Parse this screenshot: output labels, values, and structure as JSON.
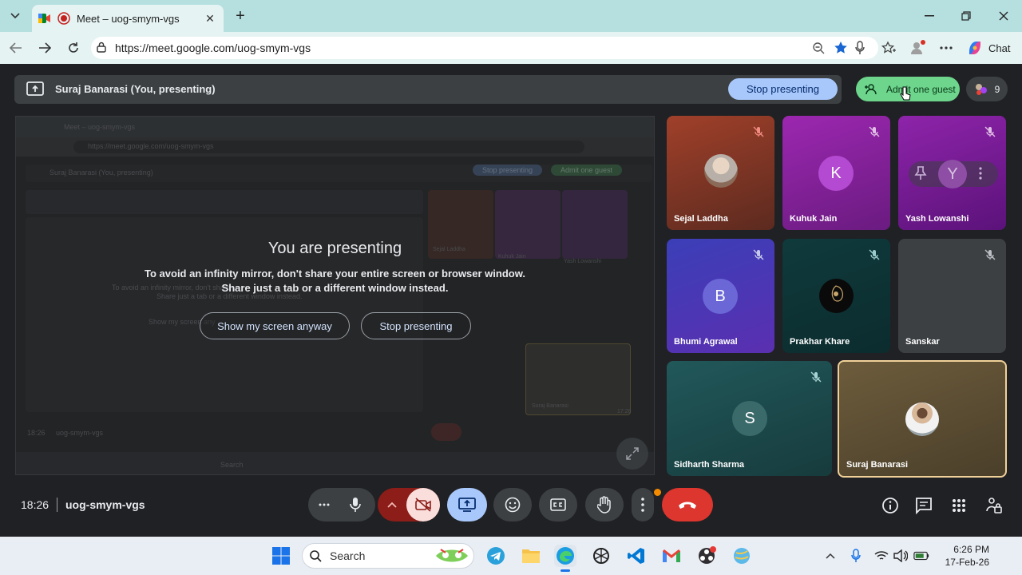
{
  "browser": {
    "tab_title": "Meet – uog-smym-vgs",
    "url": "https://meet.google.com/uog-smym-vgs",
    "chat_label": "Chat"
  },
  "meet": {
    "presenter_banner": "Suraj Banarasi (You, presenting)",
    "stop_presenting_top": "Stop presenting",
    "admit_label": "Admit one guest",
    "people_count": "9",
    "presenting": {
      "heading": "You are presenting",
      "line1": "To avoid an infinity mirror, don't share your entire screen or browser window.",
      "line2": "Share just a tab or a different window instead.",
      "show_anyway": "Show my screen anyway",
      "stop": "Stop presenting"
    },
    "participants": [
      {
        "name": "Sejal Laddha",
        "initial": "",
        "color": "#8a3a22",
        "muted": true
      },
      {
        "name": "Kuhuk Jain",
        "initial": "K",
        "color": "#8e1ea6",
        "muted": true
      },
      {
        "name": "Yash Lowanshi",
        "initial": "Y",
        "color": "#7d13a0",
        "muted": true
      },
      {
        "name": "Bhumi Agrawal",
        "initial": "B",
        "color": "#4b3ec8",
        "muted": true
      },
      {
        "name": "Prakhar Khare",
        "initial": "",
        "color": "#0f3438",
        "muted": true
      },
      {
        "name": "Sanskar",
        "initial": "",
        "color": "#3c4043",
        "muted": true
      },
      {
        "name": "Sidharth Sharma",
        "initial": "S",
        "color": "#1e4b4d",
        "muted": true
      },
      {
        "name": "Suraj Banarasi",
        "initial": "",
        "color": "#6b5a3a",
        "muted": false
      }
    ],
    "clock": "18:26",
    "meeting_code": "uog-smym-vgs"
  },
  "mini_screen": {
    "tab": "Meet – uog-smym-vgs",
    "url": "https://meet.google.com/uog-smym-vgs",
    "banner": "Suraj Banarasi (You, presenting)",
    "stop": "Stop presenting",
    "admit": "Admit one guest",
    "names": [
      "Sejal Laddha",
      "Kuhuk Jain",
      "Yash Lowanshi"
    ],
    "self": "Suraj Banarasi",
    "clock": "18:26",
    "code": "uog-smym-vgs",
    "search": "Search",
    "msg1": "To avoid an infinity mirror, don't share y",
    "msg2": "Share just a tab or a different window instead.",
    "show": "Show my screen any",
    "time_small": "17:26"
  },
  "taskbar": {
    "search_label": "Search",
    "time": "6:26 PM",
    "date": "17-Feb-26"
  },
  "colors": {
    "accent_blue": "#a8c7fa",
    "admit_green": "#6dd58c",
    "end_call_red": "#dc362e",
    "camera_off_red": "#f9dedc"
  }
}
